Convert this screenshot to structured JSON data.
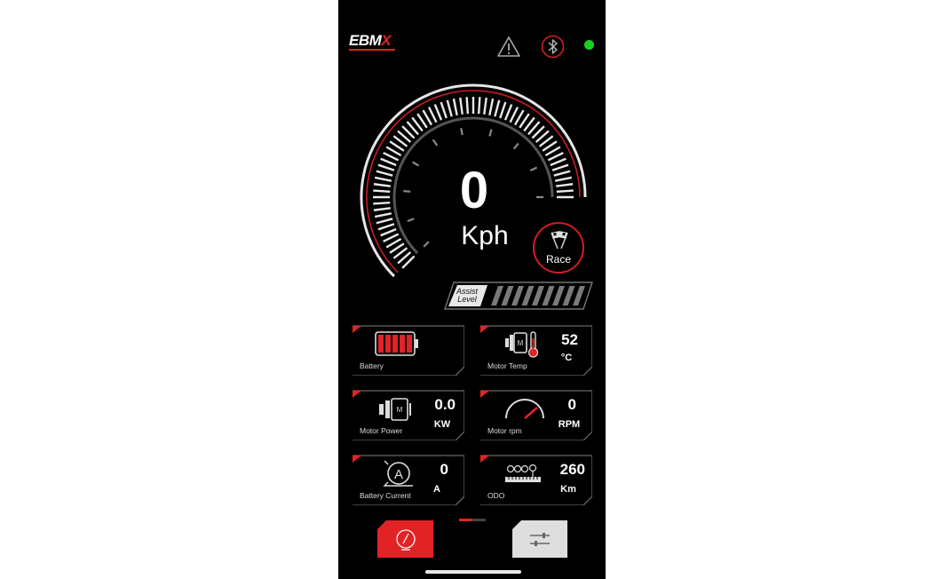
{
  "app": {
    "logo": "EBM",
    "logo_accent": "X"
  },
  "status": {
    "warning_icon": "warning-triangle-icon",
    "bluetooth_icon": "bluetooth-icon",
    "connection_color": "#19d11f"
  },
  "speedometer": {
    "speed": "0",
    "unit": "Kph"
  },
  "race_button": {
    "label": "Race",
    "icon": "checkered-flags-icon"
  },
  "assist": {
    "label_line1": "Assist",
    "label_line2": "Level",
    "level": 0,
    "max_level": 9
  },
  "cards": {
    "battery": {
      "caption": "Battery",
      "bars_filled": 5,
      "bars_total": 5
    },
    "motor_temp": {
      "caption": "Motor Temp",
      "value": "52",
      "unit": "°C"
    },
    "motor_power": {
      "caption": "Motor Power",
      "value": "0.0",
      "unit": "KW"
    },
    "motor_rpm": {
      "caption": "Motor rpm",
      "value": "0",
      "unit": "RPM"
    },
    "battery_current": {
      "caption": "Battery Current",
      "value": "0",
      "unit": "A"
    },
    "odo": {
      "caption": "ODO",
      "value": "260",
      "unit": "Km"
    }
  },
  "tabs": {
    "active": "dashboard",
    "items": [
      "dashboard-gauge-icon",
      "settings-sliders-icon"
    ]
  },
  "colors": {
    "accent": "#e22326",
    "background": "#000000"
  }
}
